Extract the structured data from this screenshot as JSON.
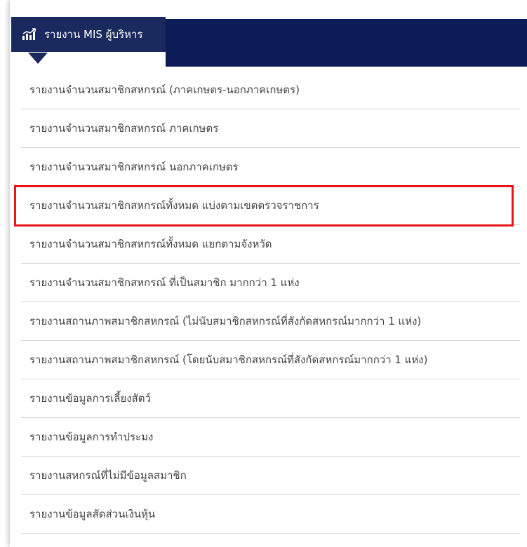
{
  "header": {
    "title": "รายงาน MIS ผู้บริหาร",
    "icon": "bar-chart-icon"
  },
  "menu": {
    "items": [
      {
        "label": "รายงานจำนวนสมาชิกสหกรณ์ (ภาคเกษตร-นอกภาคเกษตร)"
      },
      {
        "label": "รายงานจำนวนสมาชิกสหกรณ์ ภาคเกษตร"
      },
      {
        "label": "รายงานจำนวนสมาชิกสหกรณ์ นอกภาคเกษตร"
      },
      {
        "label": "รายงานจำนวนสมาชิกสหกรณ์ทั้งหมด แบ่งตามเขตตรวจราชการ"
      },
      {
        "label": "รายงานจำนวนสมาชิกสหกรณ์ทั้งหมด แยกตามจังหวัด"
      },
      {
        "label": "รายงานจำนวนสมาชิกสหกรณ์ ที่เป็นสมาชิก มากกว่า 1 แห่ง"
      },
      {
        "label": "รายงานสถานภาพสมาชิกสหกรณ์ (ไม่นับสมาชิกสหกรณ์ที่สังกัดสหกรณ์มากกว่า 1 แห่ง)"
      },
      {
        "label": "รายงานสถานภาพสมาชิกสหกรณ์ (โดยนับสมาชิกสหกรณ์ที่สังกัดสหกรณ์มากกว่า 1 แห่ง)"
      },
      {
        "label": "รายงานข้อมูลการเลี้ยงสัตว์"
      },
      {
        "label": "รายงานข้อมูลการทำประมง"
      },
      {
        "label": "รายงานสหกรณ์ที่ไม่มีข้อมูลสมาชิก"
      },
      {
        "label": "รายงานข้อมูลสัดส่วนเงินหุ้น"
      }
    ]
  },
  "colors": {
    "header_bg": "#1a2a5e",
    "header_fill": "#0c1c57",
    "highlight": "#e8141a",
    "text": "#444444",
    "divider": "#d6d6d6"
  }
}
